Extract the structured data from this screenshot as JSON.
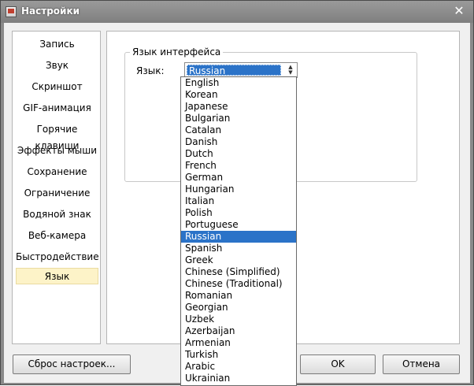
{
  "window": {
    "title": "Настройки",
    "close_symbol": "✕"
  },
  "nav": {
    "items": [
      {
        "label": "Запись"
      },
      {
        "label": "Звук"
      },
      {
        "label": "Скриншот"
      },
      {
        "label": "GIF-анимация"
      },
      {
        "label": "Горячие клавиши"
      },
      {
        "label": "Эффекты мыши"
      },
      {
        "label": "Сохранение"
      },
      {
        "label": "Ограничение"
      },
      {
        "label": "Водяной знак"
      },
      {
        "label": "Веб-камера"
      },
      {
        "label": "Быстродействие"
      },
      {
        "label": "Язык"
      }
    ],
    "selected": "Язык"
  },
  "language_group": {
    "legend": "Язык интерфейса",
    "label": "Язык:",
    "selected_value": "Russian",
    "options": [
      "English",
      "Korean",
      "Japanese",
      "Bulgarian",
      "Catalan",
      "Danish",
      "Dutch",
      "French",
      "German",
      "Hungarian",
      "Italian",
      "Polish",
      "Portuguese",
      "Russian",
      "Spanish",
      "Greek",
      "Chinese (Simplified)",
      "Chinese (Traditional)",
      "Romanian",
      "Georgian",
      "Uzbek",
      "Azerbaijan",
      "Armenian",
      "Turkish",
      "Arabic",
      "Ukrainian"
    ]
  },
  "buttons": {
    "reset": "Сброс настроек...",
    "ok": "OK",
    "cancel": "Отмена"
  }
}
